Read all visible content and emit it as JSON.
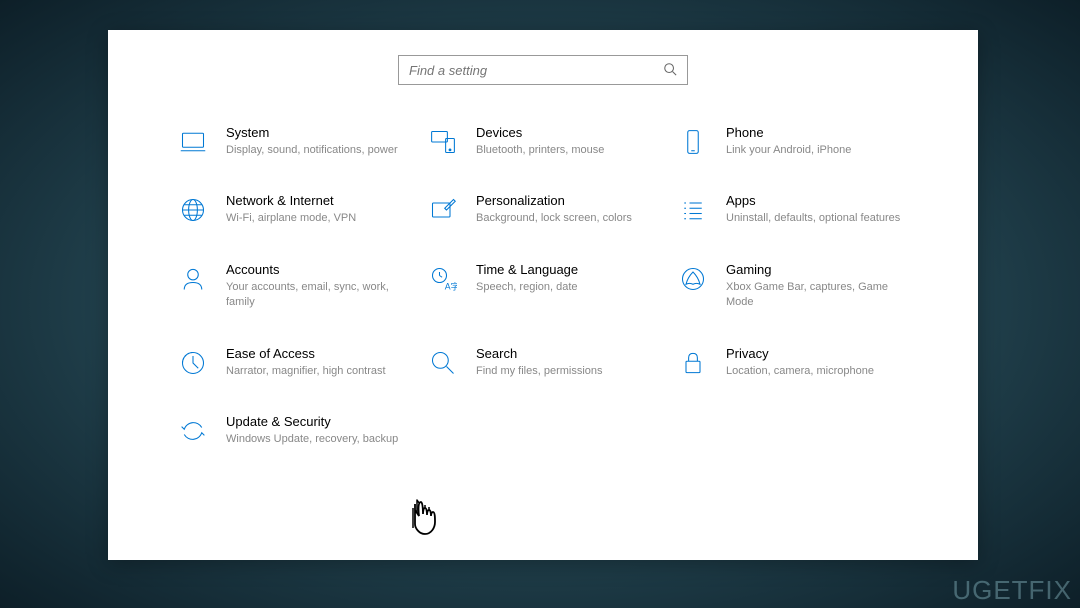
{
  "search": {
    "placeholder": "Find a setting"
  },
  "settings": [
    {
      "title": "System",
      "desc": "Display, sound, notifications, power"
    },
    {
      "title": "Devices",
      "desc": "Bluetooth, printers, mouse"
    },
    {
      "title": "Phone",
      "desc": "Link your Android, iPhone"
    },
    {
      "title": "Network & Internet",
      "desc": "Wi-Fi, airplane mode, VPN"
    },
    {
      "title": "Personalization",
      "desc": "Background, lock screen, colors"
    },
    {
      "title": "Apps",
      "desc": "Uninstall, defaults, optional features"
    },
    {
      "title": "Accounts",
      "desc": "Your accounts, email, sync, work, family"
    },
    {
      "title": "Time & Language",
      "desc": "Speech, region, date"
    },
    {
      "title": "Gaming",
      "desc": "Xbox Game Bar, captures, Game Mode"
    },
    {
      "title": "Ease of Access",
      "desc": "Narrator, magnifier, high contrast"
    },
    {
      "title": "Search",
      "desc": "Find my files, permissions"
    },
    {
      "title": "Privacy",
      "desc": "Location, camera, microphone"
    },
    {
      "title": "Update & Security",
      "desc": "Windows Update, recovery, backup"
    }
  ],
  "watermark": "UGETFIX"
}
